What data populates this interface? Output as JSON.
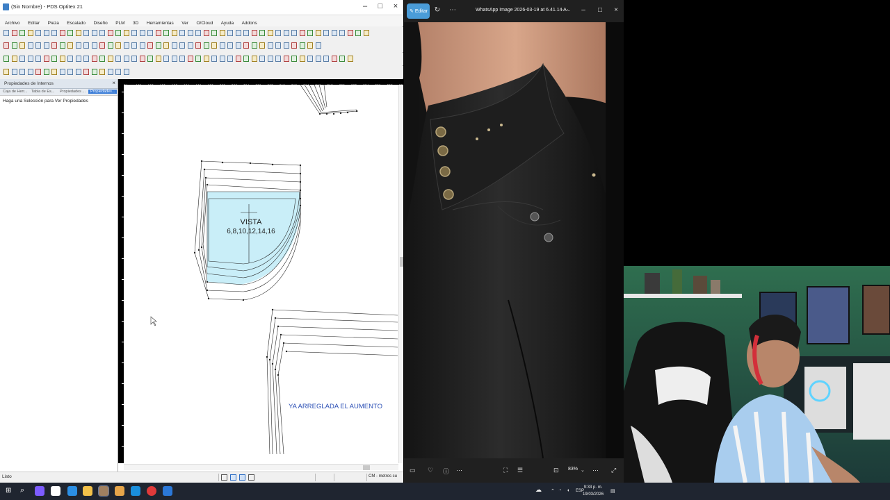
{
  "optitex": {
    "title": "(Sin Nombre) - PDS Optitex 21",
    "menu": [
      "Archivo",
      "Editar",
      "Pieza",
      "Escalado",
      "Diseño",
      "PLM",
      "3D",
      "Herramientas",
      "Ver",
      "O/Cloud",
      "Ayuda",
      "Addons"
    ],
    "properties_panel": {
      "title": "Propiedades de Internos",
      "tabs": [
        "Caja de Herr...",
        "Tabla de Es...",
        "Propiedades ...",
        "Propiedades..."
      ],
      "message": "Haga una Selección para Ver Propiedades"
    },
    "ruler_ticks": [
      "84",
      "186",
      "188",
      "190",
      "192",
      "194",
      "196",
      "198",
      "200",
      "202",
      "204",
      "206",
      "208",
      "210",
      "212",
      "214",
      "216",
      "218",
      "220",
      "222",
      "224",
      "226",
      "228",
      "230"
    ],
    "piece_label": "VISTA",
    "piece_sizes": "6,8,10,12,14,16",
    "annotation": "YA ARREGLADA EL AUMENTO",
    "status_text": "Listo",
    "units_text": "CM - metros cu"
  },
  "viewer": {
    "edit_label": "Editar",
    "title": "WhatsApp Image 2026-03-19 at 6.41.14 A...",
    "zoom": "83%"
  },
  "taskbar": {
    "language": "ESP",
    "time": "9:33 p. m.",
    "date": "19/03/2026"
  },
  "colors": {
    "piece_fill": "#c9eef8",
    "annotation": "#2b4fb5",
    "edit_button": "#4a9cd8",
    "taskbar": "#1f2530"
  }
}
